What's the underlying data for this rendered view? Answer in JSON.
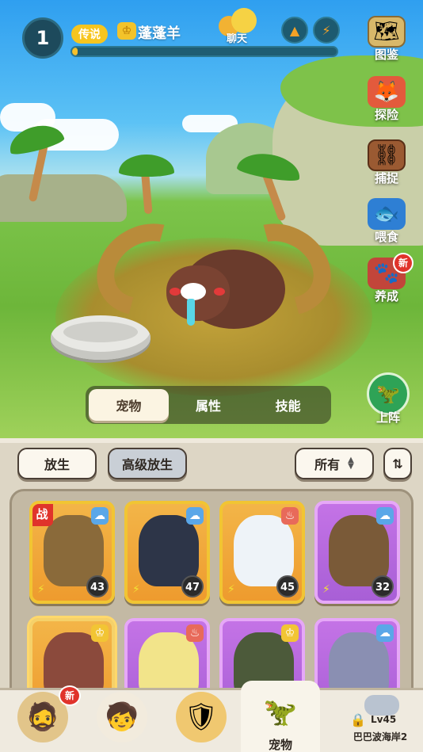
{
  "hud": {
    "player_level": "1",
    "rank_label": "传说",
    "player_name": "蓬蓬羊",
    "xp_progress": 0.02,
    "chat_label": "聊天"
  },
  "side_menu": {
    "codex": "图鉴",
    "explore": "探险",
    "capture": "捕捉",
    "feed": "喂食",
    "nurture": "养成",
    "nurture_badge": "新",
    "deploy": "上阵"
  },
  "tabs": [
    "宠物",
    "属性",
    "技能"
  ],
  "active_tab": "宠物",
  "toolbar": {
    "release": "放生",
    "advanced_release": "高级放生",
    "filter": "所有"
  },
  "pets": [
    {
      "level": "43",
      "frame": "orange",
      "element": "wind",
      "battle_tag": "战",
      "color": "#8a6a3a"
    },
    {
      "level": "47",
      "frame": "orange",
      "element": "wind",
      "color": "#2d3548"
    },
    {
      "level": "45",
      "frame": "orange",
      "element": "fire",
      "color": "#eef3f8"
    },
    {
      "level": "32",
      "frame": "purple",
      "element": "wind",
      "color": "#7a5a38"
    },
    {
      "level": "",
      "frame": "orange",
      "element": "earth",
      "color": "#8b4a3c"
    },
    {
      "level": "",
      "frame": "purple",
      "element": "fire",
      "color": "#f2e48a"
    },
    {
      "level": "",
      "frame": "purple",
      "element": "earth",
      "color": "#4c5a3a"
    },
    {
      "level": "",
      "frame": "purple",
      "element": "wind",
      "color": "#8a8fb2"
    }
  ],
  "nav": {
    "new_badge": "新",
    "active_label": "宠物",
    "locked_level": "Lv45",
    "locked_map": "巴巴波海岸2"
  },
  "colors": {
    "rank_gold": "#f7c51e",
    "hud_blue": "#1d4a5c",
    "badge_red": "#e0332b",
    "card_orange": "#f3b548",
    "card_purple": "#b86ae0"
  }
}
